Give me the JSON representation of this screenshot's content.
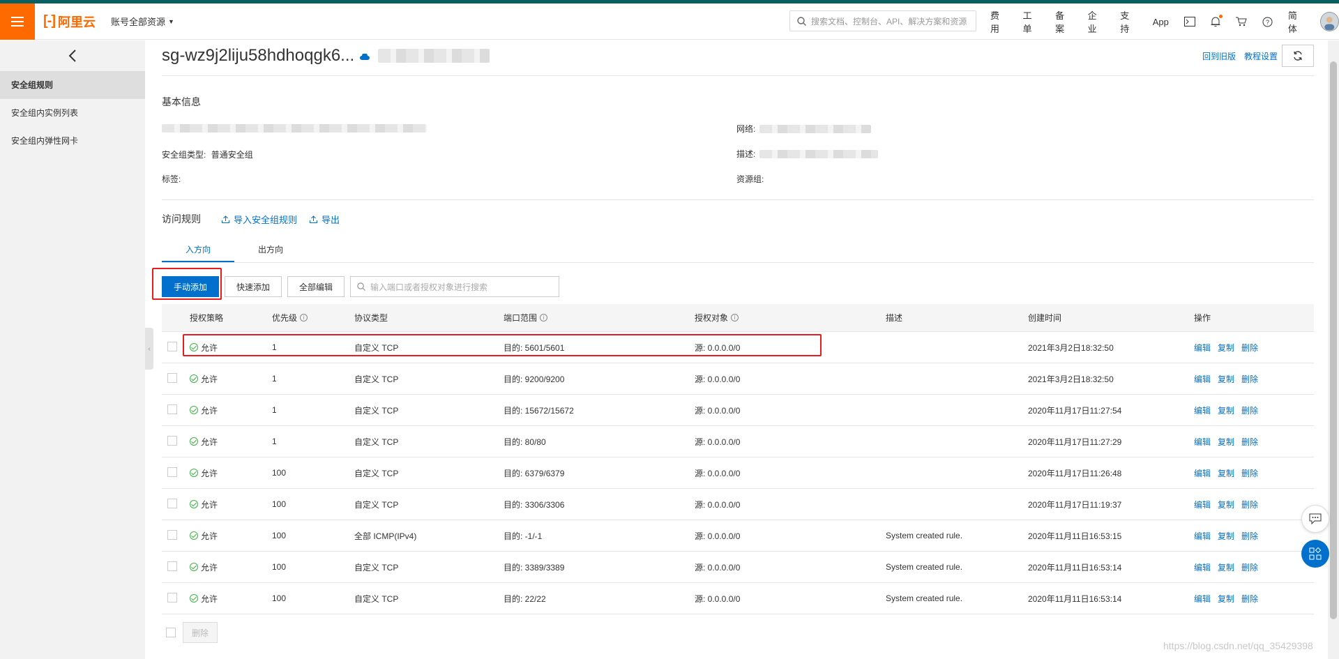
{
  "header": {
    "logo_text": "阿里云",
    "account_label": "账号全部资源",
    "search_placeholder": "搜索文档、控制台、API、解决方案和资源",
    "nav": [
      "费用",
      "工单",
      "备案",
      "企业",
      "支持",
      "App"
    ],
    "lang": "简体"
  },
  "sidebar": {
    "items": [
      {
        "label": "安全组规则"
      },
      {
        "label": "安全组内实例列表"
      },
      {
        "label": "安全组内弹性网卡"
      }
    ]
  },
  "page": {
    "title": "sg-wz9j2liju58hdhoqgk6...",
    "link_old": "回到旧版",
    "link_tutorial": "教程设置"
  },
  "basic": {
    "title": "基本信息",
    "network_label": "网络:",
    "type_label": "安全组类型:",
    "type_value": "普通安全组",
    "desc_label": "描述:",
    "tag_label": "标签:",
    "rg_label": "资源组:"
  },
  "rules": {
    "title": "访问规则",
    "import_label": "导入安全组规则",
    "export_label": "导出",
    "tab_in": "入方向",
    "tab_out": "出方向",
    "btn_manual": "手动添加",
    "btn_quick": "快速添加",
    "btn_edit_all": "全部编辑",
    "search_placeholder": "输入端口或者授权对象进行搜索",
    "columns": [
      "授权策略",
      "优先级",
      "协议类型",
      "端口范围",
      "授权对象",
      "描述",
      "创建时间",
      "操作"
    ],
    "actions": [
      "编辑",
      "复制",
      "删除"
    ],
    "delete_label": "删除",
    "rows": [
      {
        "policy": "允许",
        "priority": "1",
        "protocol": "自定义 TCP",
        "port": "目的: 5601/5601",
        "target": "源: 0.0.0.0/0",
        "desc": "",
        "time": "2021年3月2日18:32:50"
      },
      {
        "policy": "允许",
        "priority": "1",
        "protocol": "自定义 TCP",
        "port": "目的: 9200/9200",
        "target": "源: 0.0.0.0/0",
        "desc": "",
        "time": "2021年3月2日18:32:50"
      },
      {
        "policy": "允许",
        "priority": "1",
        "protocol": "自定义 TCP",
        "port": "目的: 15672/15672",
        "target": "源: 0.0.0.0/0",
        "desc": "",
        "time": "2020年11月17日11:27:54"
      },
      {
        "policy": "允许",
        "priority": "1",
        "protocol": "自定义 TCP",
        "port": "目的: 80/80",
        "target": "源: 0.0.0.0/0",
        "desc": "",
        "time": "2020年11月17日11:27:29"
      },
      {
        "policy": "允许",
        "priority": "100",
        "protocol": "自定义 TCP",
        "port": "目的: 6379/6379",
        "target": "源: 0.0.0.0/0",
        "desc": "",
        "time": "2020年11月17日11:26:48"
      },
      {
        "policy": "允许",
        "priority": "100",
        "protocol": "自定义 TCP",
        "port": "目的: 3306/3306",
        "target": "源: 0.0.0.0/0",
        "desc": "",
        "time": "2020年11月17日11:19:37"
      },
      {
        "policy": "允许",
        "priority": "100",
        "protocol": "全部 ICMP(IPv4)",
        "port": "目的: -1/-1",
        "target": "源: 0.0.0.0/0",
        "desc": "System created rule.",
        "time": "2020年11月11日16:53:15"
      },
      {
        "policy": "允许",
        "priority": "100",
        "protocol": "自定义 TCP",
        "port": "目的: 3389/3389",
        "target": "源: 0.0.0.0/0",
        "desc": "System created rule.",
        "time": "2020年11月11日16:53:14"
      },
      {
        "policy": "允许",
        "priority": "100",
        "protocol": "自定义 TCP",
        "port": "目的: 22/22",
        "target": "源: 0.0.0.0/0",
        "desc": "System created rule.",
        "time": "2020年11月11日16:53:14"
      }
    ]
  },
  "watermark": "https://blog.csdn.net/qq_35429398",
  "colors": {
    "brand": "#ff6a00",
    "link": "#0070cc",
    "highlight": "#e81c1c",
    "ok": "#3bb346"
  }
}
